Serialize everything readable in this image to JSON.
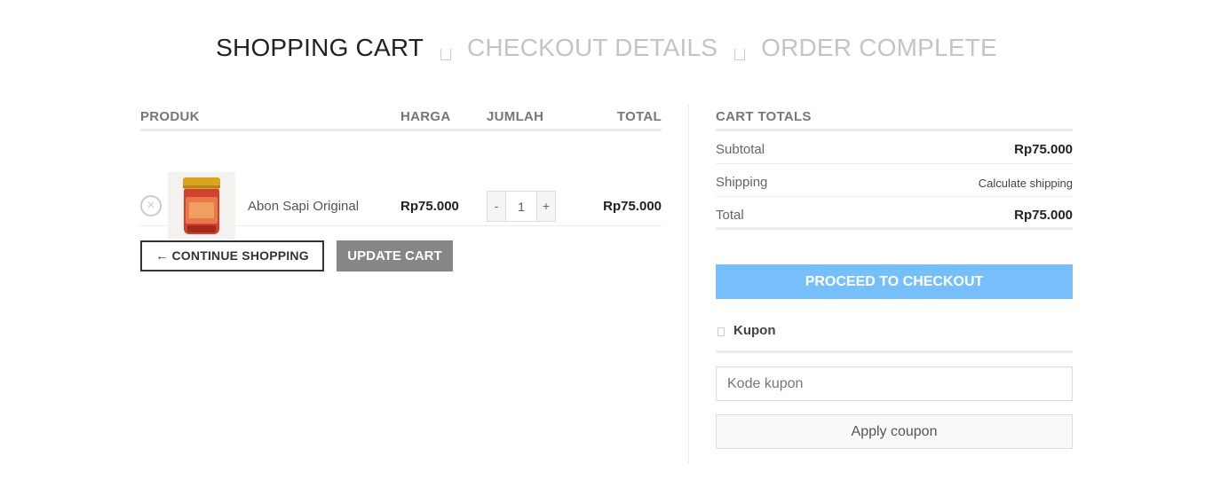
{
  "steps": {
    "step1": "SHOPPING CART",
    "step2": "CHECKOUT DETAILS",
    "step3": "ORDER COMPLETE"
  },
  "cart": {
    "headers": {
      "product": "PRODUK",
      "price": "HARGA",
      "quantity": "JUMLAH",
      "total": "TOTAL"
    },
    "items": [
      {
        "remove_symbol": "×",
        "name": "Abon Sapi Original",
        "price": "Rp75.000",
        "quantity": "1",
        "line_total": "Rp75.000",
        "minus": "-",
        "plus": "+"
      }
    ],
    "continue_label": "← CONTINUE SHOPPING",
    "update_label": "UPDATE CART"
  },
  "totals": {
    "title": "CART TOTALS",
    "subtotal_label": "Subtotal",
    "subtotal_value": "Rp75.000",
    "shipping_label": "Shipping",
    "shipping_value": "Calculate shipping",
    "total_label": "Total",
    "total_value": "Rp75.000",
    "checkout_label": "PROCEED TO CHECKOUT"
  },
  "coupon": {
    "title": "Kupon",
    "placeholder": "Kode kupon",
    "apply_label": "Apply coupon"
  },
  "colors": {
    "checkout_button": "#76bffb",
    "update_button": "#868686"
  }
}
